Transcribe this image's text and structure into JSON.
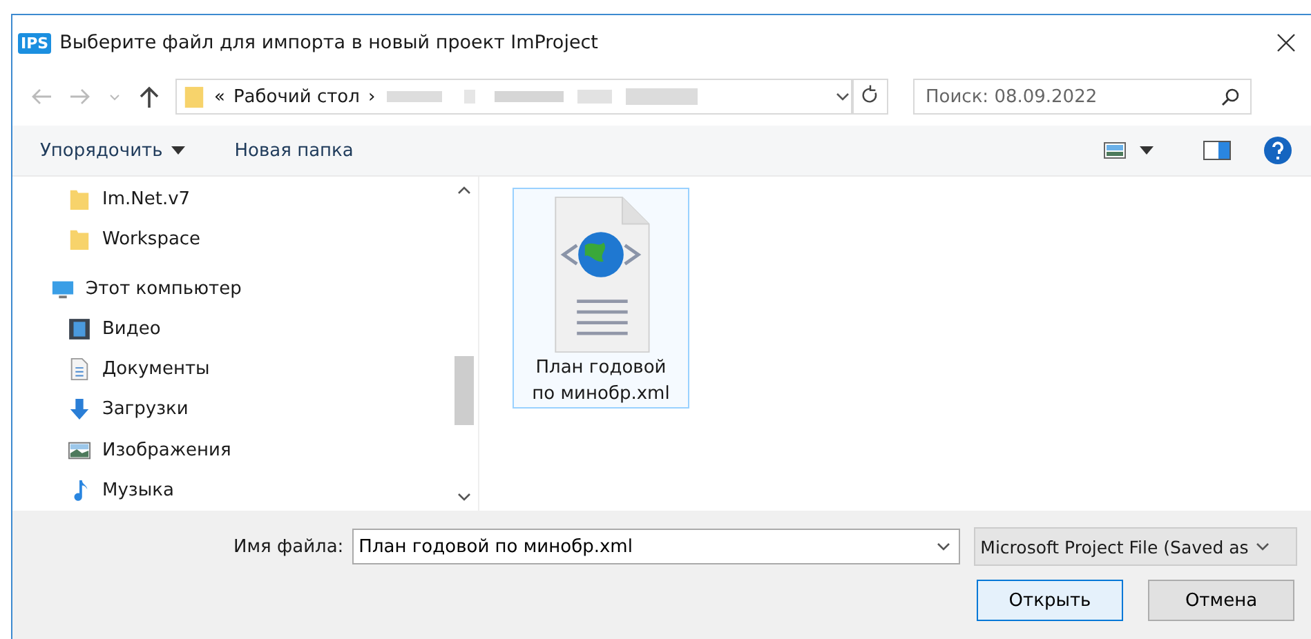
{
  "window": {
    "title": "Выберите файл для импорта в новый проект ImProject",
    "app_icon": "IPS"
  },
  "address": {
    "prefix": "«",
    "crumbs": [
      "Рабочий стол"
    ],
    "separator": "›"
  },
  "search": {
    "placeholder": "Поиск: 08.09.2022"
  },
  "toolbar": {
    "organize": "Упорядочить",
    "new_folder": "Новая папка"
  },
  "sidebar": {
    "items": [
      {
        "label": "Im.Net.v7",
        "kind": "folder"
      },
      {
        "label": "Workspace",
        "kind": "folder"
      },
      {
        "label": "Этот компьютер",
        "kind": "computer"
      },
      {
        "label": "Видео",
        "kind": "video"
      },
      {
        "label": "Документы",
        "kind": "documents"
      },
      {
        "label": "Загрузки",
        "kind": "downloads"
      },
      {
        "label": "Изображения",
        "kind": "pictures"
      },
      {
        "label": "Музыка",
        "kind": "music"
      }
    ]
  },
  "files": [
    {
      "name": "План годовой по минобр.xml",
      "selected": true
    }
  ],
  "footer": {
    "filename_label": "Имя файла:",
    "filename": "План годовой по минобр.xml",
    "filter": "Microsoft Project File (Saved as",
    "open": "Открыть",
    "cancel": "Отмена"
  }
}
